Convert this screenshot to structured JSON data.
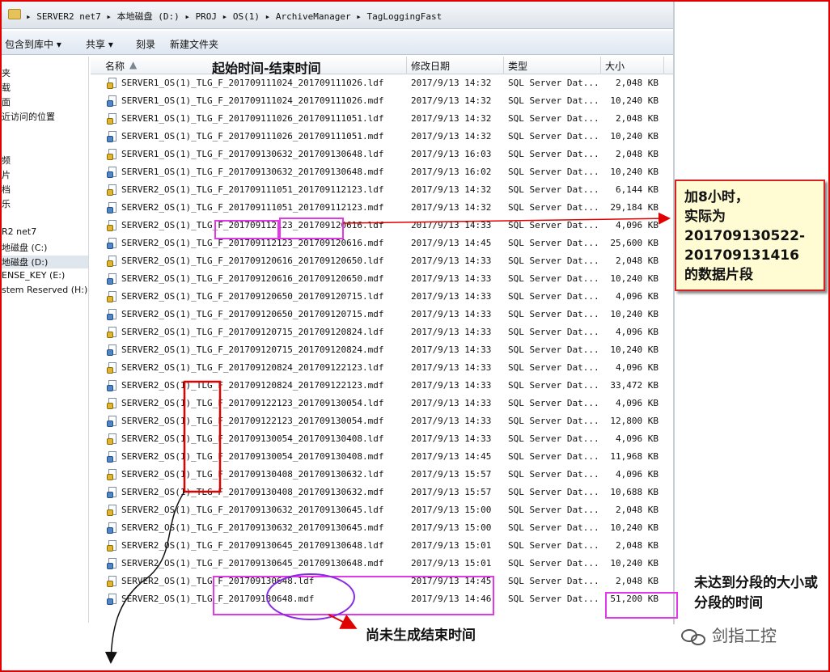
{
  "address": {
    "path": "▸ SERVER2 net7 ▸ 本地磁盘 (D:) ▸ PROJ ▸ OS(1) ▸ ArchiveManager ▸ TagLoggingFast"
  },
  "toolbar": {
    "include_library": "包含到库中 ▾",
    "share": "共享 ▾",
    "burn": "刻录",
    "new_folder": "新建文件夹"
  },
  "nav": {
    "items": [
      "夹",
      "载",
      "面",
      "近访问的位置",
      "",
      "频",
      "片",
      "档",
      "乐",
      "",
      "R2 net7",
      "地磁盘 (C:)",
      "地磁盘 (D:)",
      "ENSE_KEY (E:)",
      "stem Reserved (H:)"
    ]
  },
  "header": {
    "name": "名称",
    "date": "修改日期",
    "type": "类型",
    "size": "大小",
    "note": "起始时间-结束时间"
  },
  "files": [
    {
      "name": "SERVER1_OS(1)_TLG_F_201709111024_201709111026.ldf",
      "date": "2017/9/13 14:32",
      "type": "SQL Server Dat...",
      "size": "2,048 KB",
      "kind": "ldf"
    },
    {
      "name": "SERVER1_OS(1)_TLG_F_201709111024_201709111026.mdf",
      "date": "2017/9/13 14:32",
      "type": "SQL Server Dat...",
      "size": "10,240 KB",
      "kind": "mdf"
    },
    {
      "name": "SERVER1_OS(1)_TLG_F_201709111026_201709111051.ldf",
      "date": "2017/9/13 14:32",
      "type": "SQL Server Dat...",
      "size": "2,048 KB",
      "kind": "ldf"
    },
    {
      "name": "SERVER1_OS(1)_TLG_F_201709111026_201709111051.mdf",
      "date": "2017/9/13 14:32",
      "type": "SQL Server Dat...",
      "size": "10,240 KB",
      "kind": "mdf"
    },
    {
      "name": "SERVER1_OS(1)_TLG_F_201709130632_201709130648.ldf",
      "date": "2017/9/13 16:03",
      "type": "SQL Server Dat...",
      "size": "2,048 KB",
      "kind": "ldf"
    },
    {
      "name": "SERVER1_OS(1)_TLG_F_201709130632_201709130648.mdf",
      "date": "2017/9/13 16:02",
      "type": "SQL Server Dat...",
      "size": "10,240 KB",
      "kind": "mdf"
    },
    {
      "name": "SERVER2_OS(1)_TLG_F_201709111051_201709112123.ldf",
      "date": "2017/9/13 14:32",
      "type": "SQL Server Dat...",
      "size": "6,144 KB",
      "kind": "ldf"
    },
    {
      "name": "SERVER2_OS(1)_TLG_F_201709111051_201709112123.mdf",
      "date": "2017/9/13 14:32",
      "type": "SQL Server Dat...",
      "size": "29,184 KB",
      "kind": "mdf"
    },
    {
      "name": "SERVER2_OS(1)_TLG_F_201709112123_201709120616.ldf",
      "date": "2017/9/13 14:33",
      "type": "SQL Server Dat...",
      "size": "4,096 KB",
      "kind": "ldf"
    },
    {
      "name": "SERVER2_OS(1)_TLG_F_201709112123_201709120616.mdf",
      "date": "2017/9/13 14:45",
      "type": "SQL Server Dat...",
      "size": "25,600 KB",
      "kind": "mdf"
    },
    {
      "name": "SERVER2_OS(1)_TLG_F_201709120616_201709120650.ldf",
      "date": "2017/9/13 14:33",
      "type": "SQL Server Dat...",
      "size": "2,048 KB",
      "kind": "ldf"
    },
    {
      "name": "SERVER2_OS(1)_TLG_F_201709120616_201709120650.mdf",
      "date": "2017/9/13 14:33",
      "type": "SQL Server Dat...",
      "size": "10,240 KB",
      "kind": "mdf"
    },
    {
      "name": "SERVER2_OS(1)_TLG_F_201709120650_201709120715.ldf",
      "date": "2017/9/13 14:33",
      "type": "SQL Server Dat...",
      "size": "4,096 KB",
      "kind": "ldf"
    },
    {
      "name": "SERVER2_OS(1)_TLG_F_201709120650_201709120715.mdf",
      "date": "2017/9/13 14:33",
      "type": "SQL Server Dat...",
      "size": "10,240 KB",
      "kind": "mdf"
    },
    {
      "name": "SERVER2_OS(1)_TLG_F_201709120715_201709120824.ldf",
      "date": "2017/9/13 14:33",
      "type": "SQL Server Dat...",
      "size": "4,096 KB",
      "kind": "ldf"
    },
    {
      "name": "SERVER2_OS(1)_TLG_F_201709120715_201709120824.mdf",
      "date": "2017/9/13 14:33",
      "type": "SQL Server Dat...",
      "size": "10,240 KB",
      "kind": "mdf"
    },
    {
      "name": "SERVER2_OS(1)_TLG_F_201709120824_201709122123.ldf",
      "date": "2017/9/13 14:33",
      "type": "SQL Server Dat...",
      "size": "4,096 KB",
      "kind": "ldf"
    },
    {
      "name": "SERVER2_OS(1)_TLG_F_201709120824_201709122123.mdf",
      "date": "2017/9/13 14:33",
      "type": "SQL Server Dat...",
      "size": "33,472 KB",
      "kind": "mdf"
    },
    {
      "name": "SERVER2_OS(1)_TLG_F_201709122123_201709130054.ldf",
      "date": "2017/9/13 14:33",
      "type": "SQL Server Dat...",
      "size": "4,096 KB",
      "kind": "ldf"
    },
    {
      "name": "SERVER2_OS(1)_TLG_F_201709122123_201709130054.mdf",
      "date": "2017/9/13 14:33",
      "type": "SQL Server Dat...",
      "size": "12,800 KB",
      "kind": "mdf"
    },
    {
      "name": "SERVER2_OS(1)_TLG_F_201709130054_201709130408.ldf",
      "date": "2017/9/13 14:33",
      "type": "SQL Server Dat...",
      "size": "4,096 KB",
      "kind": "ldf"
    },
    {
      "name": "SERVER2_OS(1)_TLG_F_201709130054_201709130408.mdf",
      "date": "2017/9/13 14:45",
      "type": "SQL Server Dat...",
      "size": "11,968 KB",
      "kind": "mdf"
    },
    {
      "name": "SERVER2_OS(1)_TLG_F_201709130408_201709130632.ldf",
      "date": "2017/9/13 15:57",
      "type": "SQL Server Dat...",
      "size": "4,096 KB",
      "kind": "ldf"
    },
    {
      "name": "SERVER2_OS(1)_TLG_F_201709130408_201709130632.mdf",
      "date": "2017/9/13 15:57",
      "type": "SQL Server Dat...",
      "size": "10,688 KB",
      "kind": "mdf"
    },
    {
      "name": "SERVER2_OS(1)_TLG_F_201709130632_201709130645.ldf",
      "date": "2017/9/13 15:00",
      "type": "SQL Server Dat...",
      "size": "2,048 KB",
      "kind": "ldf"
    },
    {
      "name": "SERVER2_OS(1)_TLG_F_201709130632_201709130645.mdf",
      "date": "2017/9/13 15:00",
      "type": "SQL Server Dat...",
      "size": "10,240 KB",
      "kind": "mdf"
    },
    {
      "name": "SERVER2_OS(1)_TLG_F_201709130645_201709130648.ldf",
      "date": "2017/9/13 15:01",
      "type": "SQL Server Dat...",
      "size": "2,048 KB",
      "kind": "ldf"
    },
    {
      "name": "SERVER2_OS(1)_TLG_F_201709130645_201709130648.mdf",
      "date": "2017/9/13 15:01",
      "type": "SQL Server Dat...",
      "size": "10,240 KB",
      "kind": "mdf"
    },
    {
      "name": "SERVER2_OS(1)_TLG_F_201709130648.ldf",
      "date": "2017/9/13 14:45",
      "type": "SQL Server Dat...",
      "size": "2,048 KB",
      "kind": "ldf"
    },
    {
      "name": "SERVER2_OS(1)_TLG_F_201709130648.mdf",
      "date": "2017/9/13 14:46",
      "type": "SQL Server Dat...",
      "size": "51,200 KB",
      "kind": "mdf"
    }
  ],
  "annotations": {
    "callout_lines": [
      "加8小时，",
      "实际为",
      "201709130522-",
      "201709131416",
      "的数据片段"
    ],
    "size_note": "未达到分段的大小或分段的时间",
    "end_note": "尚未生成结束时间",
    "watermark": "剑指工控",
    "colors": {
      "red": "#e00000",
      "magenta": "#e238e8",
      "purple": "#8a2be2"
    }
  }
}
